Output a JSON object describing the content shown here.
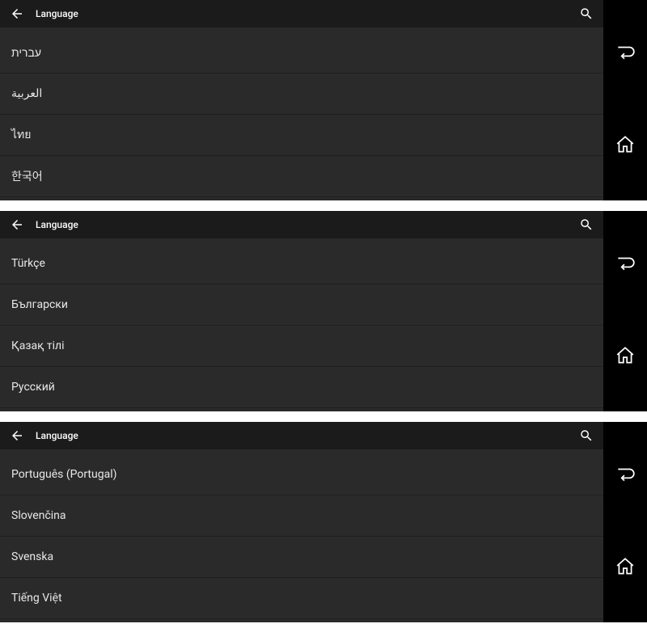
{
  "header_title": "Language",
  "panels": [
    {
      "items": [
        "עברית",
        "العربية",
        "ไทย",
        "한국어"
      ]
    },
    {
      "items": [
        "Türkçe",
        "Български",
        "Қазақ тілі",
        "Русский"
      ]
    },
    {
      "items": [
        "Português (Portugal)",
        "Slovenčina",
        "Svenska",
        "Tiếng Việt"
      ]
    }
  ]
}
